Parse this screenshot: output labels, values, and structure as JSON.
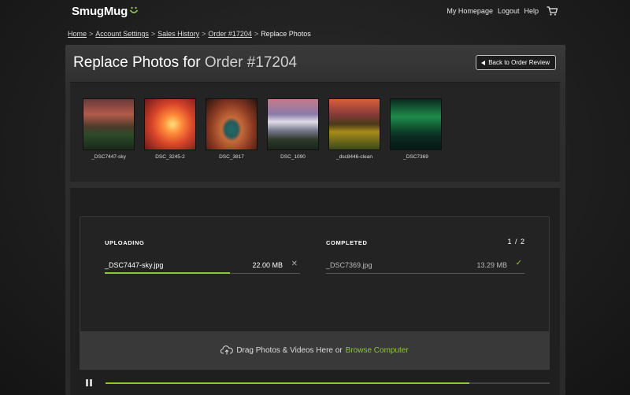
{
  "header": {
    "logo": "SmugMug",
    "nav": [
      "My Homepage",
      "Logout",
      "Help"
    ]
  },
  "breadcrumb": {
    "items": [
      "Home",
      "Account Settings",
      "Sales History",
      "Order #17204"
    ],
    "separator": ">",
    "current": "Replace Photos"
  },
  "page": {
    "title_prefix": "Replace Photos for",
    "title_order": "Order #17204",
    "back_button": "Back to Order Review"
  },
  "thumbnails": [
    {
      "caption": "_DSC7447-sky"
    },
    {
      "caption": "DSC_3245-2"
    },
    {
      "caption": "DSC_3817"
    },
    {
      "caption": "DSC_1090"
    },
    {
      "caption": "_dsc8446-clean"
    },
    {
      "caption": "_DSC7369"
    }
  ],
  "uploader": {
    "uploading_label": "UPLOADING",
    "completed_label": "COMPLETED",
    "count": "1 / 2",
    "uploading_file": {
      "name": "_DSC7447-sky.jpg",
      "size": "22.00 MB",
      "progress": 0.64
    },
    "completed_file": {
      "name": "_DSC7369.jpg",
      "size": "13.29 MB"
    },
    "drop_text": "Drag Photos & Videos Here or",
    "browse_text": "Browse Computer",
    "overall_progress": 0.82
  },
  "colors": {
    "accent": "#8cc63f",
    "background": "#1e1e1e"
  },
  "icons": [
    "cart-icon",
    "back-arrow-icon",
    "close-icon",
    "check-icon",
    "cloud-upload-icon",
    "pause-icon"
  ]
}
